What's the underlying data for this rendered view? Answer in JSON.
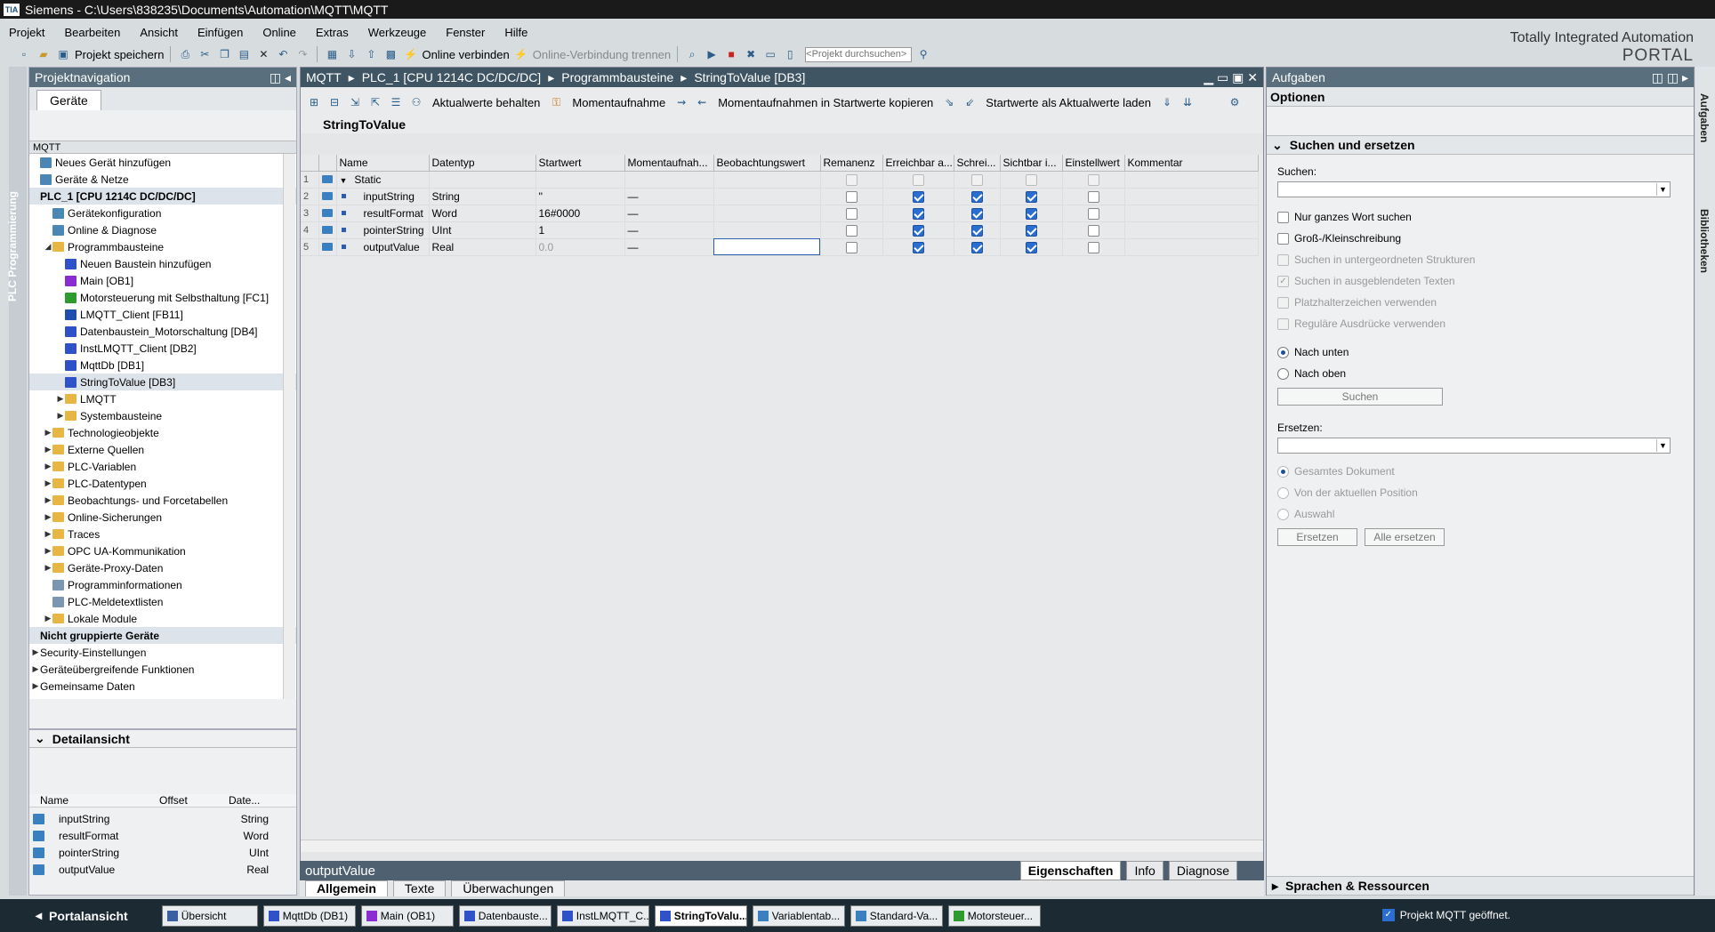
{
  "window": {
    "title": "Siemens  -  C:\\Users\\838235\\Documents\\Automation\\MQTT\\MQTT",
    "logo": "TIA"
  },
  "menu": [
    "Projekt",
    "Bearbeiten",
    "Ansicht",
    "Einfügen",
    "Online",
    "Extras",
    "Werkzeuge",
    "Fenster",
    "Hilfe"
  ],
  "toolbar": {
    "save": "Projekt speichern",
    "go_online": "Online verbinden",
    "go_offline": "Online-Verbindung trennen",
    "search_placeholder": "<Projekt durchsuchen>"
  },
  "brand": {
    "line1": "Totally Integrated Automation",
    "line2": "PORTAL"
  },
  "sidebar_tab": "PLC Programmierung",
  "projnav": {
    "title": "Projektnavigation",
    "tab": "Geräte",
    "tree_header": "MQTT",
    "items": [
      {
        "label": "Neues Gerät hinzufügen",
        "depth": 0,
        "icon": "dev"
      },
      {
        "label": "Geräte & Netze",
        "depth": 0,
        "icon": "dev"
      },
      {
        "label": "PLC_1 [CPU 1214C DC/DC/DC]",
        "depth": 0,
        "icon": "none",
        "bold": true,
        "sel": true
      },
      {
        "label": "Gerätekonfiguration",
        "depth": 1,
        "icon": "dev"
      },
      {
        "label": "Online & Diagnose",
        "depth": 1,
        "icon": "dev"
      },
      {
        "label": "Programmbausteine",
        "depth": 1,
        "icon": "folder",
        "tw": "◢"
      },
      {
        "label": "Neuen Baustein hinzufügen",
        "depth": 2,
        "icon": "db"
      },
      {
        "label": "Main [OB1]",
        "depth": 2,
        "icon": "ob"
      },
      {
        "label": "Motorsteuerung mit Selbsthaltung [FC1]",
        "depth": 2,
        "icon": "fc"
      },
      {
        "label": "LMQTT_Client [FB11]",
        "depth": 2,
        "icon": "fb"
      },
      {
        "label": "Datenbaustein_Motorschaltung [DB4]",
        "depth": 2,
        "icon": "db"
      },
      {
        "label": "InstLMQTT_Client [DB2]",
        "depth": 2,
        "icon": "db"
      },
      {
        "label": "MqttDb [DB1]",
        "depth": 2,
        "icon": "db"
      },
      {
        "label": "StringToValue [DB3]",
        "depth": 2,
        "icon": "db",
        "sel": true
      },
      {
        "label": "LMQTT",
        "depth": 2,
        "icon": "folder",
        "tw": "▶"
      },
      {
        "label": "Systembausteine",
        "depth": 2,
        "icon": "folder",
        "tw": "▶"
      },
      {
        "label": "Technologieobjekte",
        "depth": 1,
        "icon": "folder",
        "tw": "▶"
      },
      {
        "label": "Externe Quellen",
        "depth": 1,
        "icon": "folder",
        "tw": "▶"
      },
      {
        "label": "PLC-Variablen",
        "depth": 1,
        "icon": "folder",
        "tw": "▶"
      },
      {
        "label": "PLC-Datentypen",
        "depth": 1,
        "icon": "folder",
        "tw": "▶"
      },
      {
        "label": "Beobachtungs- und Forcetabellen",
        "depth": 1,
        "icon": "folder",
        "tw": "▶"
      },
      {
        "label": "Online-Sicherungen",
        "depth": 1,
        "icon": "folder",
        "tw": "▶"
      },
      {
        "label": "Traces",
        "depth": 1,
        "icon": "folder",
        "tw": "▶"
      },
      {
        "label": "OPC UA-Kommunikation",
        "depth": 1,
        "icon": "folder",
        "tw": "▶"
      },
      {
        "label": "Geräte-Proxy-Daten",
        "depth": 1,
        "icon": "folder",
        "tw": "▶"
      },
      {
        "label": "Programminformationen",
        "depth": 1,
        "icon": "gen"
      },
      {
        "label": "PLC-Meldetextlisten",
        "depth": 1,
        "icon": "gen"
      },
      {
        "label": "Lokale Module",
        "depth": 1,
        "icon": "folder",
        "tw": "▶"
      },
      {
        "label": "Nicht gruppierte Geräte",
        "depth": 0,
        "icon": "none",
        "bold": true,
        "sel": true
      },
      {
        "label": "Security-Einstellungen",
        "depth": 0,
        "icon": "none",
        "tw": "▶"
      },
      {
        "label": "Geräteübergreifende Funktionen",
        "depth": 0,
        "icon": "none",
        "tw": "▶"
      },
      {
        "label": "Gemeinsame Daten",
        "depth": 0,
        "icon": "none",
        "tw": "▶"
      }
    ]
  },
  "detail": {
    "title": "Detailansicht",
    "headers": [
      "Name",
      "Offset",
      "Date..."
    ],
    "rows": [
      [
        "inputString",
        "",
        "String"
      ],
      [
        "resultFormat",
        "",
        "Word"
      ],
      [
        "pointerString",
        "",
        "UInt"
      ],
      [
        "outputValue",
        "",
        "Real"
      ]
    ]
  },
  "editor": {
    "breadcrumb": [
      "MQTT",
      "PLC_1 [CPU 1214C DC/DC/DC]",
      "Programmbausteine",
      "StringToValue [DB3]"
    ],
    "toolbar": {
      "keep": "Aktualwerte behalten",
      "snapshot": "Momentaufnahme",
      "copy_snap": "Momentaufnahmen in Startwerte kopieren",
      "load_start": "Startwerte als Aktualwerte laden"
    },
    "block_name": "StringToValue",
    "columns": [
      "Name",
      "Datentyp",
      "Startwert",
      "Momentaufnah...",
      "Beobachtungswert",
      "Remanenz",
      "Erreichbar a...",
      "Schrei...",
      "Sichtbar i...",
      "Einstellwert",
      "Kommentar"
    ],
    "rows": [
      {
        "num": "1",
        "name": "Static",
        "type": "",
        "start": "",
        "snap": "",
        "section": true,
        "rem": "dis",
        "err": "dis",
        "sch": "dis",
        "sic": "dis",
        "ein": "dis"
      },
      {
        "num": "2",
        "name": "inputString",
        "type": "String",
        "start": "''",
        "snap": "—",
        "rem": "off",
        "err": "on",
        "sch": "on",
        "sic": "on",
        "ein": "off"
      },
      {
        "num": "3",
        "name": "resultFormat",
        "type": "Word",
        "start": "16#0000",
        "snap": "—",
        "rem": "off",
        "err": "on",
        "sch": "on",
        "sic": "on",
        "ein": "off"
      },
      {
        "num": "4",
        "name": "pointerString",
        "type": "UInt",
        "start": "1",
        "snap": "—",
        "rem": "off",
        "err": "on",
        "sch": "on",
        "sic": "on",
        "ein": "off"
      },
      {
        "num": "5",
        "name": "outputValue",
        "type": "Real",
        "start": "0.0",
        "snap": "—",
        "rem": "off",
        "err": "on",
        "sch": "on",
        "sic": "on",
        "ein": "off"
      }
    ]
  },
  "inspector": {
    "title": "outputValue",
    "tabs": [
      "Eigenschaften",
      "Info",
      "Diagnose"
    ],
    "subtabs": [
      "Allgemein",
      "Texte",
      "Überwachungen"
    ]
  },
  "tasks": {
    "title": "Aufgaben",
    "options": "Optionen",
    "section": "Suchen und ersetzen",
    "search_label": "Suchen:",
    "checks": [
      {
        "label": "Nur ganzes Wort suchen",
        "state": "off"
      },
      {
        "label": "Groß-/Kleinschreibung",
        "state": "off"
      },
      {
        "label": "Suchen in untergeordneten Strukturen",
        "state": "dis"
      },
      {
        "label": "Suchen in ausgeblendeten Texten",
        "state": "dison"
      },
      {
        "label": "Platzhalterzeichen verwenden",
        "state": "dis"
      },
      {
        "label": "Reguläre Ausdrücke verwenden",
        "state": "dis"
      }
    ],
    "dir_down": "Nach unten",
    "dir_up": "Nach oben",
    "search_btn": "Suchen",
    "replace_label": "Ersetzen:",
    "scope": [
      "Gesamtes Dokument",
      "Von der aktuellen Position",
      "Auswahl"
    ],
    "replace_btn": "Ersetzen",
    "replace_all_btn": "Alle ersetzen",
    "lang": "Sprachen & Ressourcen"
  },
  "rightstrip": [
    "Aufgaben",
    "Bibliotheken"
  ],
  "taskbar": {
    "portal": "Portalansicht",
    "tabs": [
      {
        "label": "Übersicht",
        "color": "#3a5fa0"
      },
      {
        "label": "MqttDb (DB1)",
        "color": "#2f52c8"
      },
      {
        "label": "Main (OB1)",
        "color": "#8a2ccf"
      },
      {
        "label": "Datenbauste...",
        "color": "#2f52c8"
      },
      {
        "label": "InstLMQTT_C...",
        "color": "#2f52c8"
      },
      {
        "label": "StringToValu...",
        "color": "#2f52c8",
        "act": true
      },
      {
        "label": "Variablentab...",
        "color": "#3a7fc0"
      },
      {
        "label": "Standard-Va...",
        "color": "#3a7fc0"
      },
      {
        "label": "Motorsteuer...",
        "color": "#2e9b2e"
      }
    ],
    "status": "Projekt MQTT geöffnet."
  }
}
